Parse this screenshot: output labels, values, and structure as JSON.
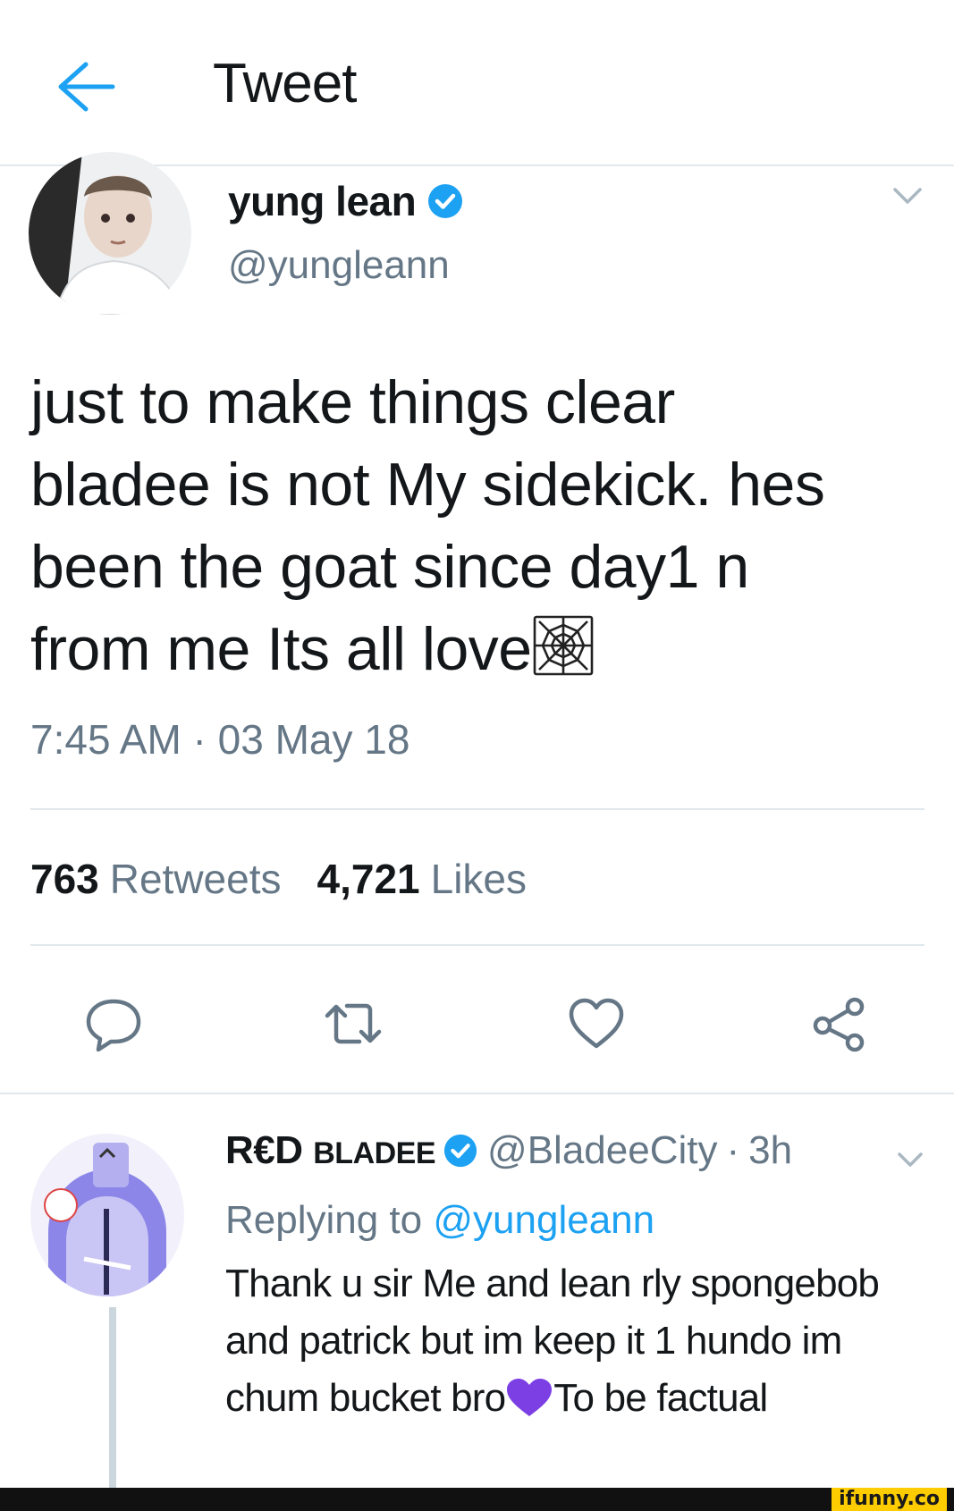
{
  "header": {
    "title": "Tweet",
    "back_icon": "arrow-left-icon"
  },
  "tweet": {
    "author_name": "yung lean",
    "author_handle": "@yungleann",
    "text_lines": [
      "just to make things clear",
      "bladee is not My sidekick. hes",
      "been the goat since day1 n",
      "from me Its all love"
    ],
    "text_emoji": "spider-web-icon",
    "timestamp": "7:45 AM · 03 May 18",
    "retweets_count": "763",
    "retweets_label": "Retweets",
    "likes_count": "4,721",
    "likes_label": "Likes"
  },
  "actions": {
    "reply_icon": "reply-icon",
    "retweet_icon": "retweet-icon",
    "like_icon": "heart-icon",
    "share_icon": "share-icon"
  },
  "reply": {
    "author_name_prefix": "R€D ",
    "author_name_rest": "BLADEE",
    "author_handle": "@BladeeCity",
    "separator": "·",
    "time": "3h",
    "replying_label": "Replying to",
    "replying_handle": "@yungleann",
    "text_before_emoji": "Thank u sir Me and lean rly spongebob and patrick but im keep it 1 hundo im chum bucket bro",
    "text_after_emoji": "To be factual",
    "emoji": "purple-heart-icon"
  },
  "watermark": "ifunny.co",
  "colors": {
    "accent": "#1da1f2",
    "muted": "#657786",
    "divider": "#e1e8ed",
    "purple": "#7b3fe4"
  }
}
